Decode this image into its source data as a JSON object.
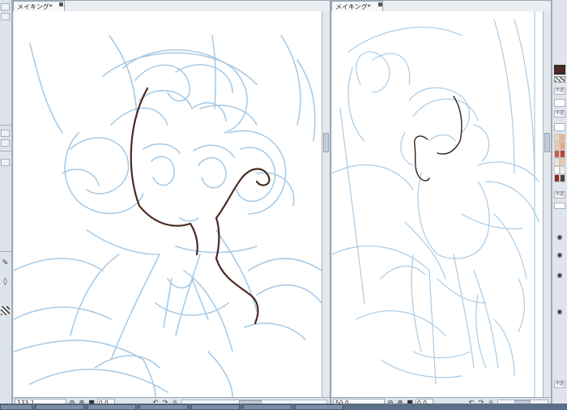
{
  "documents": [
    {
      "tab_title": "メイキング*",
      "zoom": "133.1",
      "angle": "0.0"
    },
    {
      "tab_title": "メイキング*",
      "zoom": "50.0",
      "angle": "0.0"
    }
  ],
  "icons": {
    "zoom_out": "zoom-out-icon",
    "zoom_in": "zoom-in-icon",
    "fit": "fit-icon",
    "rotate_left": "rotate-left-icon",
    "rotate_right": "rotate-right-icon",
    "reset_rotation": "reset-rotation-icon"
  },
  "layer_buttons": [
    "不透",
    "不透",
    "不透",
    "不透"
  ],
  "colors": {
    "sketch": "#a9cbe6",
    "lineart": "#4a2a22",
    "ui_panel": "#eaeef2",
    "taskbar": "#5b6f88"
  },
  "palette": [
    "#f3d2b5",
    "#e9b48f",
    "#f0c9a8",
    "#e6a77f",
    "#c85c4d",
    "#b6453b",
    "#f6e4cf",
    "#e8c6a7",
    "#ffffff",
    "#efefef",
    "#8c2a25",
    "#444444"
  ]
}
